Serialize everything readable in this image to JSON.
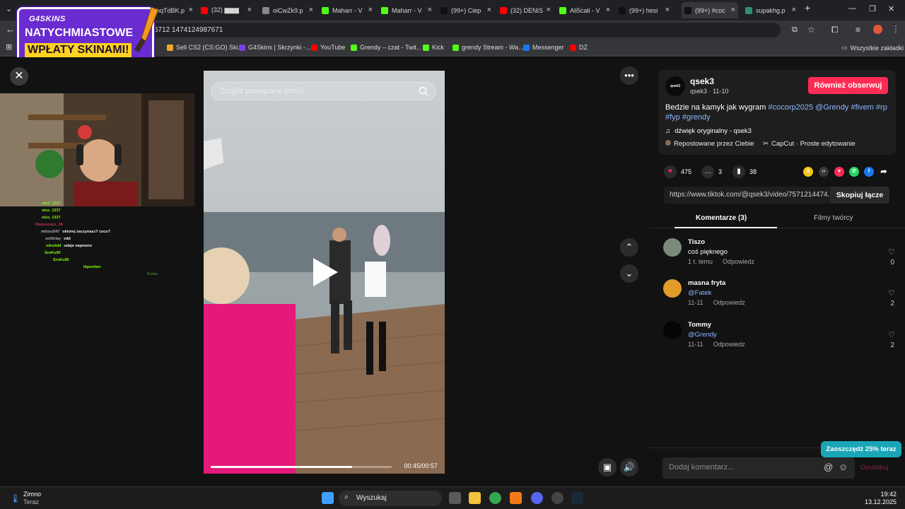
{
  "browser": {
    "tabs": [
      {
        "title": "ghqTdBK.p",
        "favicon_color": "#2f8f2f"
      },
      {
        "title": "(32) ▆▆▆",
        "favicon_color": "#ff0000"
      },
      {
        "title": "oiCwZk9.p",
        "favicon_color": "#888888"
      },
      {
        "title": "Maharr - V",
        "favicon_color": "#53fc18"
      },
      {
        "title": "Maharr - V",
        "favicon_color": "#53fc18"
      },
      {
        "title": "(99+) Ciep",
        "favicon_color": "#111111"
      },
      {
        "title": "(32) DENIS",
        "favicon_color": "#ff0000"
      },
      {
        "title": "Ali5cali - V",
        "favicon_color": "#53fc18"
      },
      {
        "title": "(99+) hesi",
        "favicon_color": "#111111"
      },
      {
        "title": "(99+) #coc",
        "favicon_color": "#111111"
      },
      {
        "title": "supakhg.p",
        "favicon_color": "#2f8f6f"
      }
    ],
    "active_tab_index": 9,
    "new_tab_label": "+",
    "url": "5712 1474124987671",
    "bookmarks": [
      {
        "label": "Sell CS2 (CS:GO) Ski...",
        "color": "#f5a623"
      },
      {
        "label": "G4Skins | Skrzynki -...",
        "color": "#7b3fe4"
      },
      {
        "label": "YouTube",
        "color": "#ff0000"
      },
      {
        "label": "Grendy – czat - Twit...",
        "color": "#53fc18"
      },
      {
        "label": "Kick",
        "color": "#53fc18"
      },
      {
        "label": "grendy Stream - Wa...",
        "color": "#53fc18"
      },
      {
        "label": "Messenger",
        "color": "#1877f2"
      },
      {
        "label": "DZ",
        "color": "#ff0000"
      }
    ],
    "all_bookmarks": "Wszystkie zakładki"
  },
  "promo": {
    "brand": "G4SKINS",
    "line1": "NATYCHMIASTOWE",
    "line2": "WPŁATY SKINAMI!"
  },
  "stream_chat": [
    {
      "user": "olus_1337",
      "msg": "",
      "color": "#7cfc00"
    },
    {
      "user": "olus_1337",
      "msg": "",
      "color": "#7cfc00"
    },
    {
      "user": "olus_1337",
      "msg": "",
      "color": "#7cfc00"
    },
    {
      "user": "Mamusiaxx_38",
      "msg": "",
      "color": "#c0304a"
    },
    {
      "user": "milosz547",
      "msg": "oktorej zaczynasz? coco?",
      "color": "#b0b0b0"
    },
    {
      "user": "xolifclay",
      "msg": "xdd",
      "color": "#b0b0b0"
    },
    {
      "user": "nikoddd",
      "msg": "udaje napewno",
      "color": "#7cfc00"
    },
    {
      "user": "SroKu90",
      "msg": "",
      "color": "#7cfc00"
    },
    {
      "user": "SroKu90",
      "msg": "",
      "color": "#7cfc00"
    },
    {
      "user": "lilpumber",
      "msg": "",
      "color": "#7cfc00"
    },
    {
      "user": "Sroku",
      "msg": "",
      "color": "#3a7a2a"
    }
  ],
  "video": {
    "search_placeholder": "Znajdź powiązane treści",
    "progress": 0.78,
    "time": "00:45/00:57"
  },
  "post": {
    "avatar_text": "qsek3",
    "author": "qsek3",
    "author_sub": "qsek3 · 11-10",
    "follow_label": "Również obserwuj",
    "desc_text": "Bedzie na kamyk jak wygram ",
    "desc_tags": "#cocorp2025 @Grendy #fivem #rp #fyp #grendy",
    "sound": "dźwięk oryginalny - qsek3",
    "repost": "Repostowane przez Ciebie",
    "capcut": "CapCut · Proste edytowanie",
    "likes": "475",
    "comments": "3",
    "saves": "38",
    "link": "https://www.tiktok.com/@qsek3/video/7571214474...",
    "copy_label": "Skopiuj łącze",
    "tab_comments": "Komentarze (3)",
    "tab_creator": "Filmy twórcy"
  },
  "comments": [
    {
      "name": "Tiszo",
      "text": "coś pięknego",
      "time": "1 t. temu",
      "reply": "Odpowiedz",
      "likes": "0",
      "avatar_color": "#7a8a7a",
      "is_tag": false
    },
    {
      "name": "masna fryta",
      "text": "@Fatek",
      "time": "11-11",
      "reply": "Odpowiedz",
      "likes": "2",
      "avatar_color": "#e39b2a",
      "is_tag": true
    },
    {
      "name": "Tommy",
      "text": "@Grendy",
      "time": "11-11",
      "reply": "Odpowiedz",
      "likes": "2",
      "avatar_color": "#050505",
      "is_tag": true
    }
  ],
  "comment_box": {
    "placeholder": "Dodaj komentarz...",
    "publish": "Opublikuj"
  },
  "save_badge": "Zaoszczędź 25% teraz",
  "taskbar": {
    "weather": "Zimno",
    "weather_sub": "Teraz",
    "search": "Wyszukaj",
    "time": "19:42",
    "date": "13.12.2025"
  },
  "colors": {
    "accent": "#fe2c55",
    "tag": "#8cb5ff"
  }
}
